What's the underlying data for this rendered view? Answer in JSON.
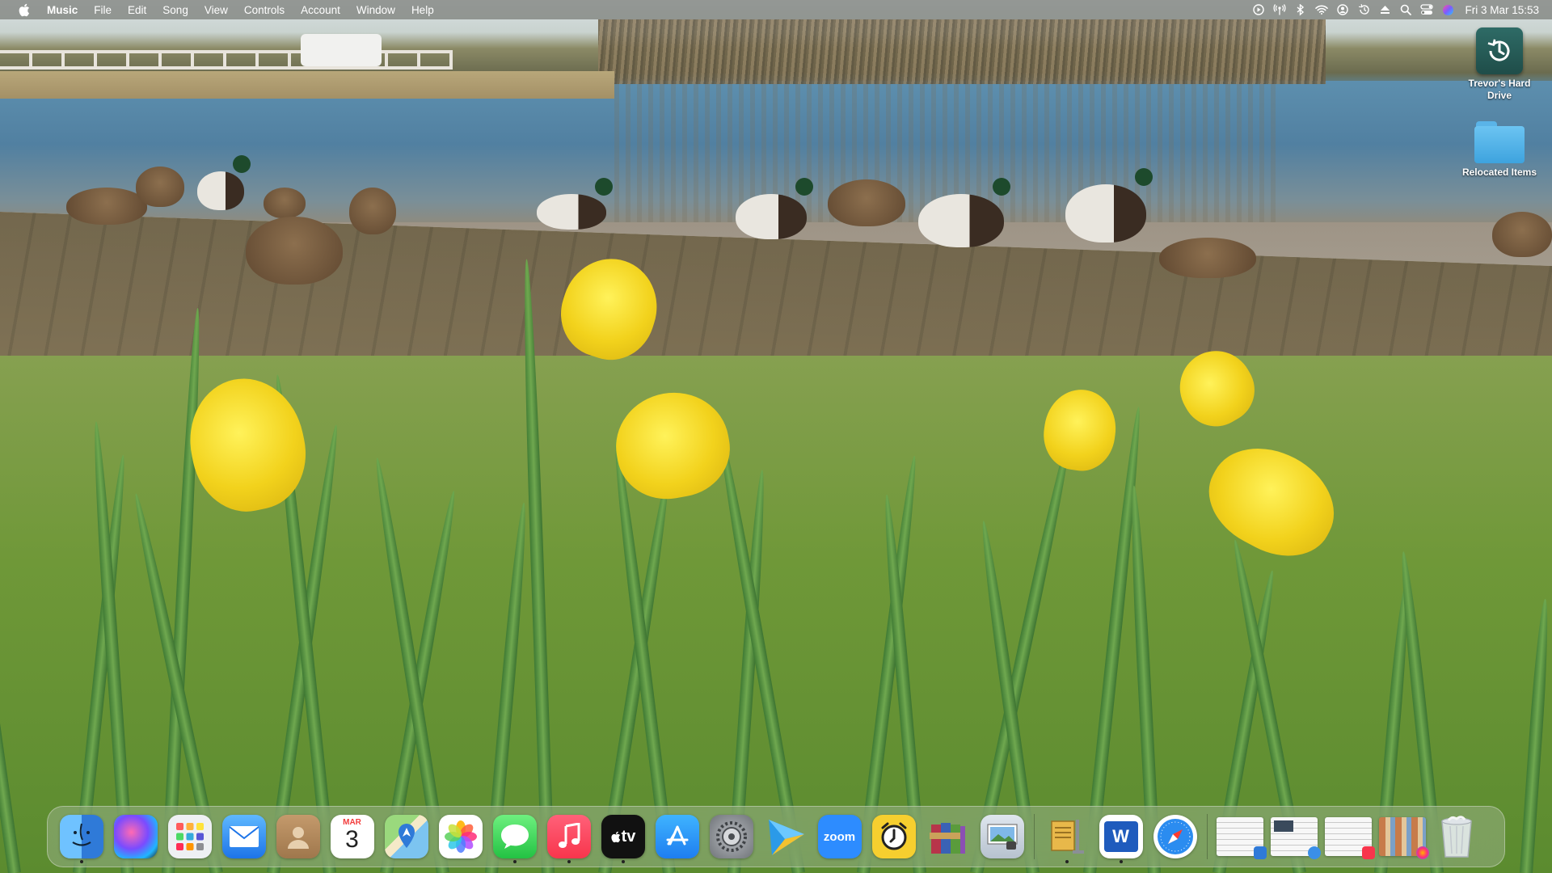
{
  "menubar": {
    "apple_icon": "apple-logo-icon",
    "app_name": "Music",
    "menus": [
      "File",
      "Edit",
      "Song",
      "View",
      "Controls",
      "Account",
      "Window",
      "Help"
    ],
    "status_icons": [
      "play-circle-icon",
      "radio-tower-icon",
      "bluetooth-icon",
      "wifi-icon",
      "user-circle-icon",
      "time-machine-icon",
      "eject-icon",
      "search-icon",
      "control-center-icon",
      "siri-icon"
    ],
    "clock": "Fri 3 Mar  15:53"
  },
  "desktop": {
    "icons": [
      {
        "name": "time-machine-drive-icon",
        "label": "Trevor's Hard Drive"
      },
      {
        "name": "folder-icon",
        "label": "Relocated Items"
      }
    ]
  },
  "dock": {
    "apps": [
      {
        "name": "finder",
        "icon": "finder-icon",
        "running": true
      },
      {
        "name": "siri",
        "icon": "siri-icon",
        "running": false
      },
      {
        "name": "launchpad",
        "icon": "launchpad-icon",
        "running": false
      },
      {
        "name": "mail",
        "icon": "mail-icon",
        "running": false
      },
      {
        "name": "contacts",
        "icon": "contacts-icon",
        "running": false
      },
      {
        "name": "calendar",
        "icon": "calendar-icon",
        "running": false,
        "month": "MAR",
        "day": "3"
      },
      {
        "name": "maps",
        "icon": "maps-icon",
        "running": false
      },
      {
        "name": "photos",
        "icon": "photos-icon",
        "running": false
      },
      {
        "name": "messages",
        "icon": "messages-icon",
        "running": true
      },
      {
        "name": "music",
        "icon": "music-icon",
        "running": true
      },
      {
        "name": "apple-tv",
        "icon": "apple-tv-icon",
        "running": true,
        "text": "tv"
      },
      {
        "name": "app-store",
        "icon": "app-store-icon",
        "running": false
      },
      {
        "name": "system-settings",
        "icon": "system-settings-icon",
        "running": false
      },
      {
        "name": "media-player",
        "icon": "play-triangle-icon",
        "running": false
      },
      {
        "name": "zoom",
        "icon": "zoom-icon",
        "running": false,
        "text": "zoom"
      },
      {
        "name": "alarm-clock",
        "icon": "alarm-clock-icon",
        "running": false
      },
      {
        "name": "winrar",
        "icon": "archive-books-icon",
        "running": false
      },
      {
        "name": "preview",
        "icon": "preview-icon",
        "running": false
      },
      {
        "name": "archive-utility",
        "icon": "archive-utility-icon",
        "running": true
      },
      {
        "name": "word",
        "icon": "word-icon",
        "running": true,
        "text": "W"
      },
      {
        "name": "safari",
        "icon": "safari-icon",
        "running": false
      }
    ],
    "stacks": [
      {
        "name": "document-stack-1",
        "icon": "document-thumbnail-icon"
      },
      {
        "name": "document-stack-2",
        "icon": "document-thumbnail-icon"
      },
      {
        "name": "document-stack-3",
        "icon": "document-thumbnail-icon"
      },
      {
        "name": "document-stack-4",
        "icon": "document-thumbnail-icon"
      }
    ],
    "trash": {
      "name": "trash",
      "icon": "trash-icon"
    }
  },
  "colors": {
    "menubar_bg": "#787c76",
    "dock_bg": "#aab9a0",
    "finder_blue": "#2f7ad8",
    "music_red": "#fa3c55",
    "messages_green": "#3ed35c",
    "zoom_blue": "#2d8cff",
    "word_blue": "#1f5bbd"
  }
}
